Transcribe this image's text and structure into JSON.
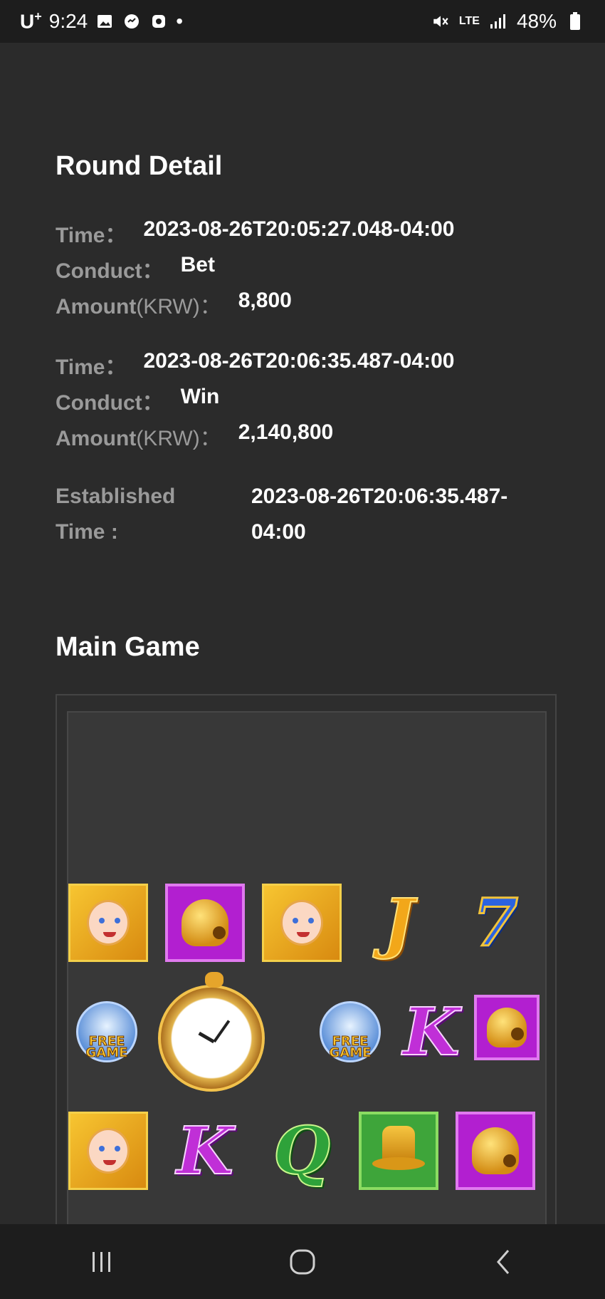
{
  "status_bar": {
    "carrier": "U",
    "carrier_sup": "+",
    "time": "9:24",
    "dot": "•",
    "network": "LTE",
    "battery": "48%"
  },
  "round_detail": {
    "title": "Round Detail",
    "entries": [
      {
        "time_label": "Time：",
        "time_value": "2023-08-26T20:05:27.048-04:00",
        "conduct_label": "Conduct：",
        "conduct_value": "Bet",
        "amount_label": "Amount",
        "amount_unit": "(KRW)：",
        "amount_value": "8,800"
      },
      {
        "time_label": "Time：",
        "time_value": "2023-08-26T20:06:35.487-04:00",
        "conduct_label": "Conduct：",
        "conduct_value": "Win",
        "amount_label": "Amount",
        "amount_unit": "(KRW)：",
        "amount_value": "2,140,800"
      }
    ],
    "established_label_1": "Established",
    "established_label_2": "Time :",
    "established_value_1": "2023-08-26T20:06:35.487-",
    "established_value_2": "04:00"
  },
  "main_game": {
    "title": "Main Game",
    "symbols": {
      "letter_j": "J",
      "letter_seven": "7",
      "letter_k": "K",
      "letter_q": "Q",
      "free_game_1": "FREE",
      "free_game_2": "GAME"
    }
  }
}
